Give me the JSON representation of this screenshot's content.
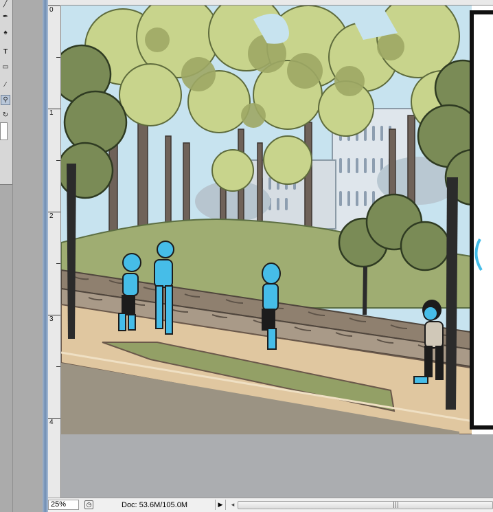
{
  "toolbox": {
    "tools": [
      {
        "name": "brush-tool-icon",
        "glyph": "╱"
      },
      {
        "name": "pen-tool-icon",
        "glyph": "✒"
      },
      {
        "name": "dodge-tool-icon",
        "glyph": "♠"
      },
      {
        "name": "type-tool-icon",
        "glyph": "T"
      },
      {
        "name": "rectangle-tool-icon",
        "glyph": "▭"
      },
      {
        "name": "eyedropper-tool-icon",
        "glyph": "⁄"
      },
      {
        "name": "zoom-tool-icon",
        "glyph": "⚲"
      },
      {
        "name": "rotate-view-tool-icon",
        "glyph": "↻"
      }
    ]
  },
  "ruler": {
    "vertical_labels": [
      "0",
      "1",
      "2",
      "3",
      "4"
    ]
  },
  "status": {
    "zoom": "25%",
    "doc_info": "Doc: 53.6M/105.0M",
    "menu_arrow": "▶",
    "scroll_left": "◂"
  },
  "colors": {
    "selection_blue": "#46bde8",
    "panel_border": "#111111"
  }
}
